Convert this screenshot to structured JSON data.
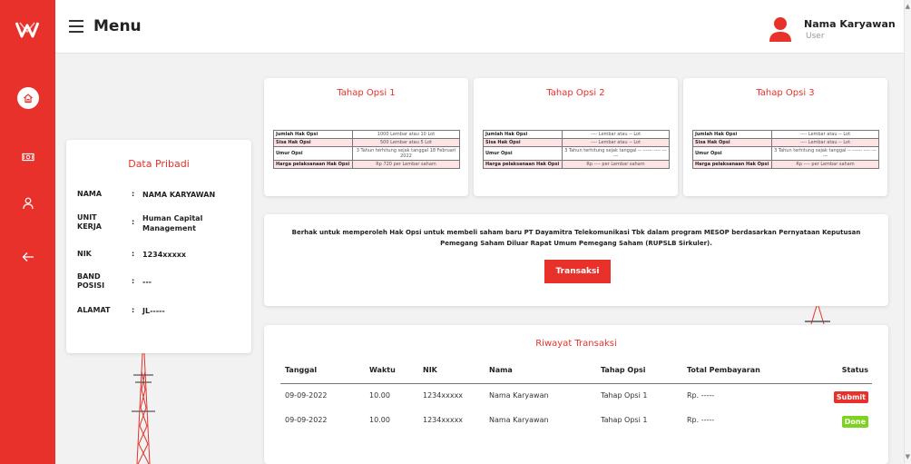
{
  "header": {
    "menu_title": "Menu",
    "user_name": "Nama Karyawan",
    "user_role": "User"
  },
  "sidebar": {
    "items": [
      {
        "icon": "home-icon"
      },
      {
        "icon": "money-icon"
      },
      {
        "icon": "user-icon"
      },
      {
        "icon": "arrow-left-icon"
      }
    ]
  },
  "profile": {
    "title": "Data Pribadi",
    "colon": ":",
    "rows": [
      {
        "label": "NAMA",
        "value": "NAMA KARYAWAN"
      },
      {
        "label": "UNIT KERJA",
        "value": "Human Capital Management"
      },
      {
        "label": "NIK",
        "value": "1234xxxxx"
      },
      {
        "label": "BAND POSISI",
        "value": "---"
      },
      {
        "label": "ALAMAT",
        "value": "JL-----"
      }
    ]
  },
  "opsi": [
    {
      "title": "Tahap Opsi 1",
      "rows": [
        {
          "key": "Jumlah Hak Opsi",
          "value": "1000 Lembar atau 10 Lot"
        },
        {
          "key": "Sisa Hak Opsi",
          "value": "500 Lembar atau 5 Lot"
        },
        {
          "key": "Umur Opsi",
          "value": "3 Tahun terhitung sejak tanggal 18 Februari 2022"
        },
        {
          "key": "Harga pelaksanaan Hak Opsi",
          "value": "Rp 720 per Lembar saham"
        }
      ]
    },
    {
      "title": "Tahap Opsi 2",
      "rows": [
        {
          "key": "Jumlah Hak Opsi",
          "value": "---- Lembar atau -- Lot"
        },
        {
          "key": "Sisa Hak Opsi",
          "value": "---- Lembar atau -- Lot"
        },
        {
          "key": "Umur Opsi",
          "value": "3 Tahun terhitung sejak tanggal -- ------ ---- ------"
        },
        {
          "key": "Harga pelaksanaan Hak Opsi",
          "value": "Rp ---- per Lembar saham"
        }
      ]
    },
    {
      "title": "Tahap Opsi 3",
      "rows": [
        {
          "key": "Jumlah Hak Opsi",
          "value": "---- Lembar atau -- Lot"
        },
        {
          "key": "Sisa Hak Opsi",
          "value": "---- Lembar atau -- Lot"
        },
        {
          "key": "Umur Opsi",
          "value": "3 Tahun terhitung sejak tanggal -- ------ ---- ------"
        },
        {
          "key": "Harga pelaksanaan Hak Opsi",
          "value": "Rp ---- per Lembar saham"
        }
      ]
    }
  ],
  "info": {
    "text": "Berhak untuk memperoleh Hak Opsi untuk membeli saham baru PT Dayamitra Telekomunikasi Tbk dalam program MESOP berdasarkan Pernyataan Keputusan Pemegang Saham Diluar Rapat Umum Pemegang Saham (RUPSLB Sirkuler).",
    "button_label": "Transaksi"
  },
  "riwayat": {
    "title": "Riwayat Transaksi",
    "columns": [
      "Tanggal",
      "Waktu",
      "NIK",
      "Nama",
      "Tahap Opsi",
      "Total Pembayaran",
      "Status"
    ],
    "rows": [
      {
        "tanggal": "09-09-2022",
        "waktu": "10.00",
        "nik": "1234xxxxx",
        "nama": "Nama Karyawan",
        "tahap": "Tahap Opsi 1",
        "total": "Rp. -----",
        "status": "Submit"
      },
      {
        "tanggal": "09-09-2022",
        "waktu": "10.00",
        "nik": "1234xxxxx",
        "nama": "Nama Karyawan",
        "tahap": "Tahap Opsi 1",
        "total": "Rp. -----",
        "status": "Done"
      }
    ]
  },
  "colors": {
    "accent": "#e8312a",
    "done": "#7ed321"
  }
}
